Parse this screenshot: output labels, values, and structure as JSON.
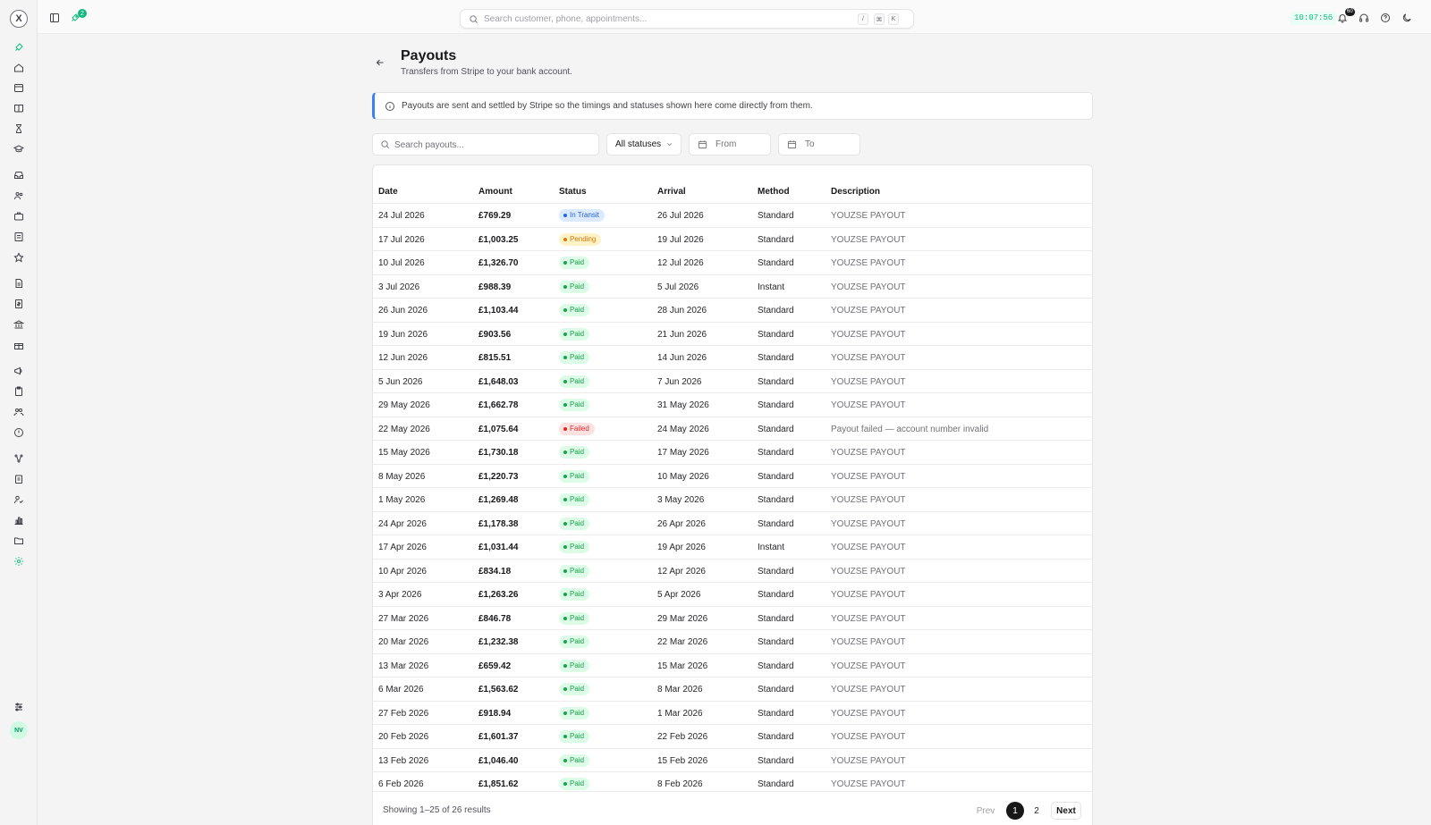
{
  "topbar": {
    "search_placeholder": "Search customer, phone, appointments...",
    "kbd_keys": [
      "/",
      "⌘",
      "K"
    ],
    "rocket_badge": "2",
    "clock": "10:07:56",
    "notification_count": "60"
  },
  "sidebar": {
    "logo": "X",
    "avatar_initials": "NV",
    "icons": [
      "rocket-icon",
      "home-icon",
      "calendar-icon",
      "book-icon",
      "hourglass-icon",
      "graduation-cap-icon",
      "inbox-icon",
      "users-icon",
      "briefcase-icon",
      "receipt-icon",
      "star-icon",
      "document-icon",
      "invoice-icon",
      "bank-icon",
      "gift-icon",
      "megaphone-icon",
      "clipboard-icon",
      "team-icon",
      "alert-circle-icon",
      "integrations-icon",
      "clipboard-list-icon",
      "user-check-icon",
      "bar-chart-icon",
      "folder-icon",
      "settings-icon",
      "sliders-icon"
    ]
  },
  "header": {
    "title": "Payouts",
    "subtitle": "Transfers from Stripe to your bank account."
  },
  "info_banner": {
    "text": "Payouts are sent and settled by Stripe so the timings and statuses shown here come directly from them."
  },
  "filters": {
    "search_placeholder": "Search payouts...",
    "status_value": "All statuses",
    "from_placeholder": "From",
    "to_placeholder": "To"
  },
  "table": {
    "columns": [
      "Date",
      "Amount",
      "Status",
      "Arrival",
      "Method",
      "Description"
    ],
    "rows": [
      {
        "date": "24 Jul 2026",
        "amount": "£769.29",
        "status": "In Transit",
        "arrival": "26 Jul 2026",
        "method": "Standard",
        "description": "YOUZSE PAYOUT"
      },
      {
        "date": "17 Jul 2026",
        "amount": "£1,003.25",
        "status": "Pending",
        "arrival": "19 Jul 2026",
        "method": "Standard",
        "description": "YOUZSE PAYOUT"
      },
      {
        "date": "10 Jul 2026",
        "amount": "£1,326.70",
        "status": "Paid",
        "arrival": "12 Jul 2026",
        "method": "Standard",
        "description": "YOUZSE PAYOUT"
      },
      {
        "date": "3 Jul 2026",
        "amount": "£988.39",
        "status": "Paid",
        "arrival": "5 Jul 2026",
        "method": "Instant",
        "description": "YOUZSE PAYOUT"
      },
      {
        "date": "26 Jun 2026",
        "amount": "£1,103.44",
        "status": "Paid",
        "arrival": "28 Jun 2026",
        "method": "Standard",
        "description": "YOUZSE PAYOUT"
      },
      {
        "date": "19 Jun 2026",
        "amount": "£903.56",
        "status": "Paid",
        "arrival": "21 Jun 2026",
        "method": "Standard",
        "description": "YOUZSE PAYOUT"
      },
      {
        "date": "12 Jun 2026",
        "amount": "£815.51",
        "status": "Paid",
        "arrival": "14 Jun 2026",
        "method": "Standard",
        "description": "YOUZSE PAYOUT"
      },
      {
        "date": "5 Jun 2026",
        "amount": "£1,648.03",
        "status": "Paid",
        "arrival": "7 Jun 2026",
        "method": "Standard",
        "description": "YOUZSE PAYOUT"
      },
      {
        "date": "29 May 2026",
        "amount": "£1,662.78",
        "status": "Paid",
        "arrival": "31 May 2026",
        "method": "Standard",
        "description": "YOUZSE PAYOUT"
      },
      {
        "date": "22 May 2026",
        "amount": "£1,075.64",
        "status": "Failed",
        "arrival": "24 May 2026",
        "method": "Standard",
        "description": "Payout failed — account number invalid"
      },
      {
        "date": "15 May 2026",
        "amount": "£1,730.18",
        "status": "Paid",
        "arrival": "17 May 2026",
        "method": "Standard",
        "description": "YOUZSE PAYOUT"
      },
      {
        "date": "8 May 2026",
        "amount": "£1,220.73",
        "status": "Paid",
        "arrival": "10 May 2026",
        "method": "Standard",
        "description": "YOUZSE PAYOUT"
      },
      {
        "date": "1 May 2026",
        "amount": "£1,269.48",
        "status": "Paid",
        "arrival": "3 May 2026",
        "method": "Standard",
        "description": "YOUZSE PAYOUT"
      },
      {
        "date": "24 Apr 2026",
        "amount": "£1,178.38",
        "status": "Paid",
        "arrival": "26 Apr 2026",
        "method": "Standard",
        "description": "YOUZSE PAYOUT"
      },
      {
        "date": "17 Apr 2026",
        "amount": "£1,031.44",
        "status": "Paid",
        "arrival": "19 Apr 2026",
        "method": "Instant",
        "description": "YOUZSE PAYOUT"
      },
      {
        "date": "10 Apr 2026",
        "amount": "£834.18",
        "status": "Paid",
        "arrival": "12 Apr 2026",
        "method": "Standard",
        "description": "YOUZSE PAYOUT"
      },
      {
        "date": "3 Apr 2026",
        "amount": "£1,263.26",
        "status": "Paid",
        "arrival": "5 Apr 2026",
        "method": "Standard",
        "description": "YOUZSE PAYOUT"
      },
      {
        "date": "27 Mar 2026",
        "amount": "£846.78",
        "status": "Paid",
        "arrival": "29 Mar 2026",
        "method": "Standard",
        "description": "YOUZSE PAYOUT"
      },
      {
        "date": "20 Mar 2026",
        "amount": "£1,232.38",
        "status": "Paid",
        "arrival": "22 Mar 2026",
        "method": "Standard",
        "description": "YOUZSE PAYOUT"
      },
      {
        "date": "13 Mar 2026",
        "amount": "£659.42",
        "status": "Paid",
        "arrival": "15 Mar 2026",
        "method": "Standard",
        "description": "YOUZSE PAYOUT"
      },
      {
        "date": "6 Mar 2026",
        "amount": "£1,563.62",
        "status": "Paid",
        "arrival": "8 Mar 2026",
        "method": "Standard",
        "description": "YOUZSE PAYOUT"
      },
      {
        "date": "27 Feb 2026",
        "amount": "£918.94",
        "status": "Paid",
        "arrival": "1 Mar 2026",
        "method": "Standard",
        "description": "YOUZSE PAYOUT"
      },
      {
        "date": "20 Feb 2026",
        "amount": "£1,601.37",
        "status": "Paid",
        "arrival": "22 Feb 2026",
        "method": "Standard",
        "description": "YOUZSE PAYOUT"
      },
      {
        "date": "13 Feb 2026",
        "amount": "£1,046.40",
        "status": "Paid",
        "arrival": "15 Feb 2026",
        "method": "Standard",
        "description": "YOUZSE PAYOUT"
      },
      {
        "date": "6 Feb 2026",
        "amount": "£1,851.62",
        "status": "Paid",
        "arrival": "8 Feb 2026",
        "method": "Standard",
        "description": "YOUZSE PAYOUT"
      }
    ]
  },
  "pagination": {
    "summary": "Showing 1–25 of 26 results",
    "prev": "Prev",
    "pages": [
      "1",
      "2"
    ],
    "next": "Next"
  },
  "colors": {
    "accent": "#10b981",
    "info_border": "#3b82f6",
    "paid": "#16a34a",
    "transit": "#2563eb",
    "pending": "#d97706",
    "failed": "#dc2626"
  }
}
